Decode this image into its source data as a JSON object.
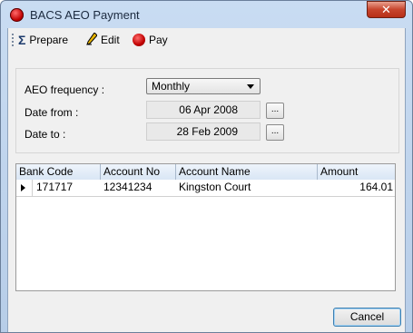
{
  "window": {
    "title": "BACS AEO Payment"
  },
  "toolbar": {
    "items": [
      {
        "label": "Prepare",
        "icon": "sigma-icon"
      },
      {
        "label": "Edit",
        "icon": "pencil-icon"
      },
      {
        "label": "Pay",
        "icon": "pay-icon"
      }
    ]
  },
  "form": {
    "frequency_label": "AEO frequency :",
    "frequency_value": "Monthly",
    "date_from_label": "Date from :",
    "date_from_value": "06 Apr 2008",
    "date_to_label": "Date to :",
    "date_to_value": "28 Feb 2009",
    "browse_label": "..."
  },
  "table": {
    "headers": [
      "Bank Code",
      "Account No",
      "Account Name",
      "Amount"
    ],
    "rows": [
      [
        "171717",
        "12341234",
        "Kingston Court",
        "164.01"
      ]
    ]
  },
  "footer": {
    "cancel_label": "Cancel"
  }
}
